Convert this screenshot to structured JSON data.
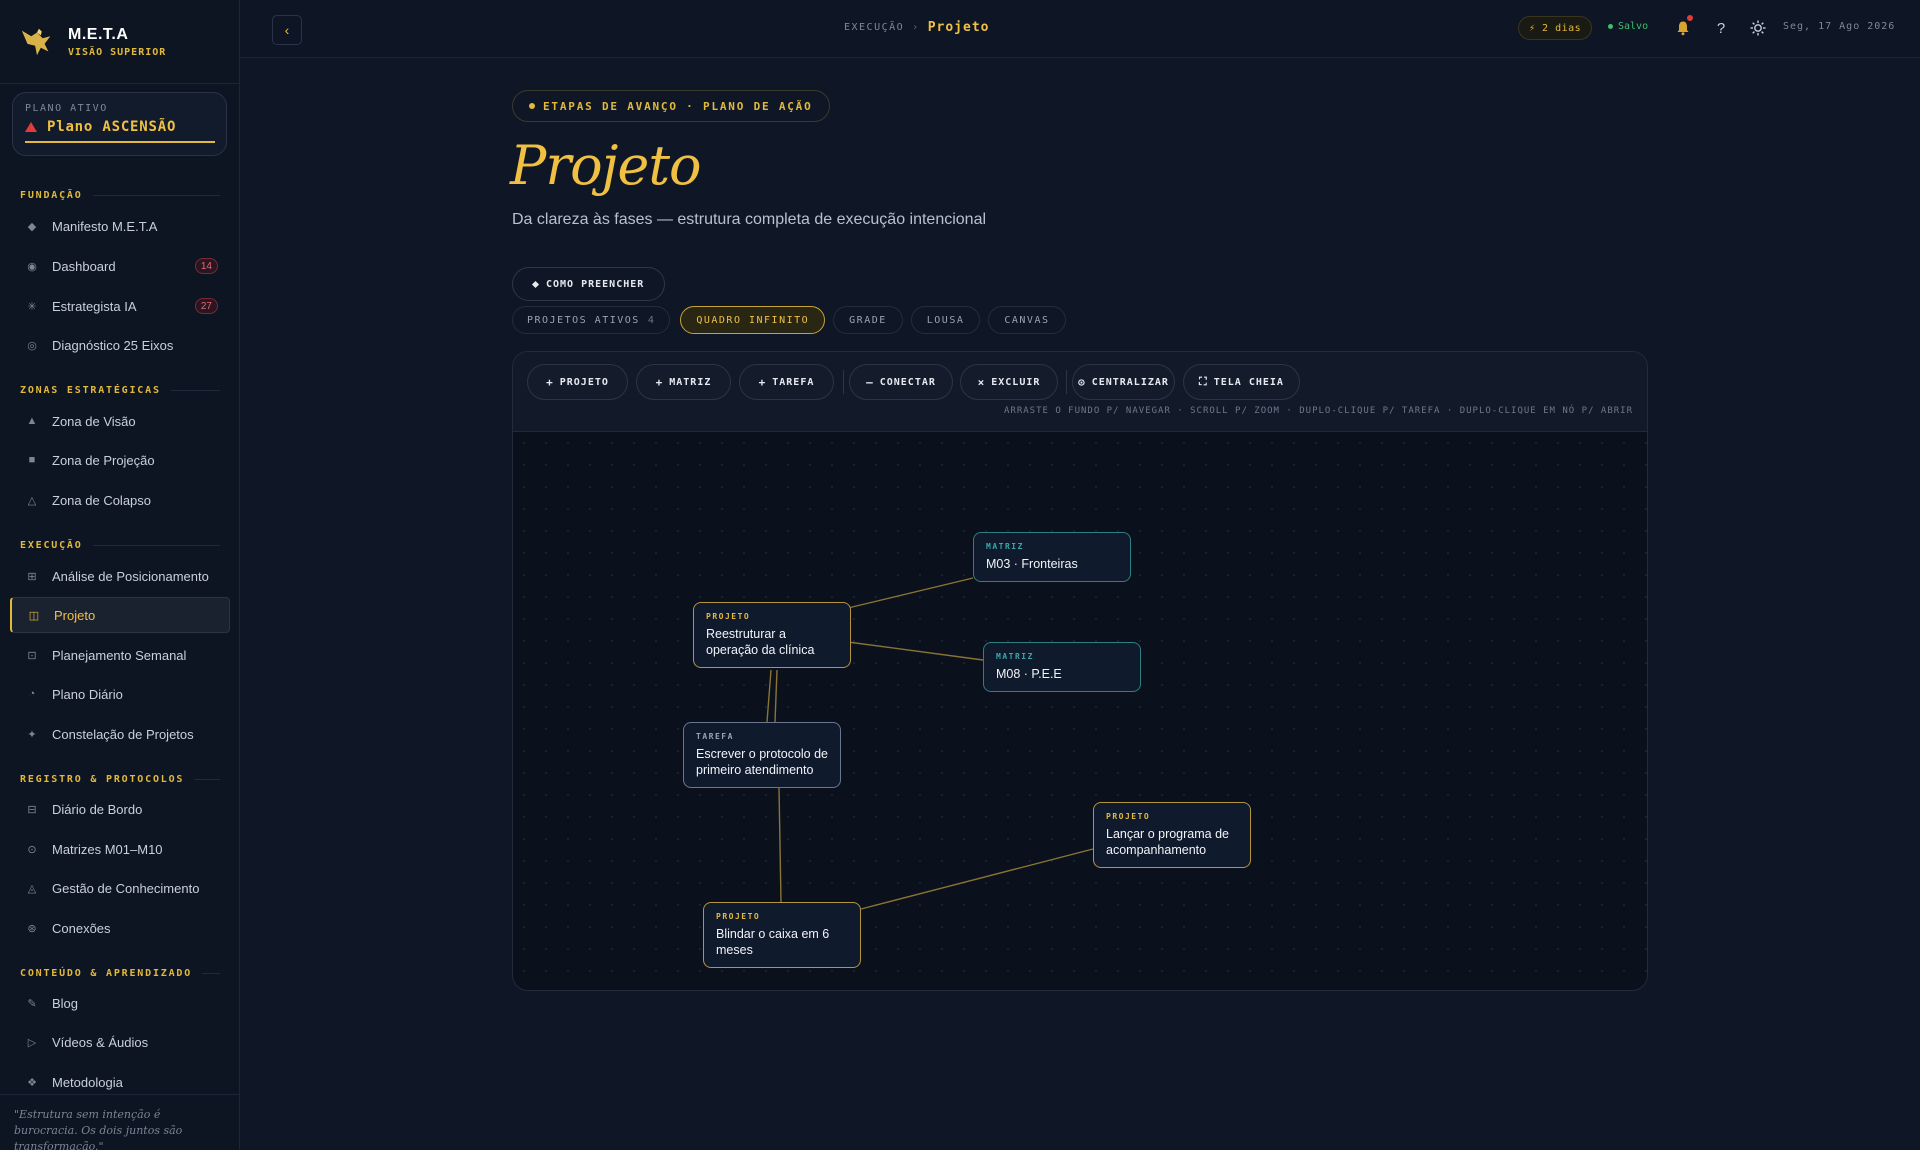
{
  "brand": {
    "name": "M.E.T.A",
    "subtitle": "VISÃO SUPERIOR"
  },
  "plan": {
    "label": "PLANO ATIVO",
    "name": "Plano ASCENSÃO"
  },
  "sidebar": {
    "sections": [
      {
        "title": "FUNDAÇÃO"
      },
      {
        "title": "ZONAS ESTRATÉGICAS"
      },
      {
        "title": "EXECUÇÃO"
      },
      {
        "title": "REGISTRO & PROTOCOLOS"
      },
      {
        "title": "CONTEÚDO & APRENDIZADO"
      }
    ],
    "items": [
      {
        "label": "Manifesto M.E.T.A",
        "icon": "◆"
      },
      {
        "label": "Dashboard",
        "icon": "◉",
        "badge": "14"
      },
      {
        "label": "Estrategista IA",
        "icon": "✳",
        "badge": "27"
      },
      {
        "label": "Diagnóstico 25 Eixos",
        "icon": "◎"
      },
      {
        "label": "Zona de Visão",
        "icon": "▲"
      },
      {
        "label": "Zona de Projeção",
        "icon": "■"
      },
      {
        "label": "Zona de Colapso",
        "icon": "△"
      },
      {
        "label": "Análise de Posicionamento",
        "icon": "⊞"
      },
      {
        "label": "Projeto",
        "icon": "◫"
      },
      {
        "label": "Planejamento Semanal",
        "icon": "⊡"
      },
      {
        "label": "Plano Diário",
        "icon": "◔"
      },
      {
        "label": "Constelação de Projetos",
        "icon": "✦"
      },
      {
        "label": "Diário de Bordo",
        "icon": "⊟"
      },
      {
        "label": "Matrizes M01–M10",
        "icon": "⊙"
      },
      {
        "label": "Gestão de Conhecimento",
        "icon": "◬"
      },
      {
        "label": "Conexões",
        "icon": "⊛"
      },
      {
        "label": "Blog",
        "icon": "✎"
      },
      {
        "label": "Vídeos & Áudios",
        "icon": "▷"
      },
      {
        "label": "Metodologia",
        "icon": "❖"
      }
    ],
    "quote": "\"Estrutura sem intenção é burocracia. Os dois juntos são transformação.\""
  },
  "topbar": {
    "back": "‹",
    "crumb_parent": "EXECUÇÃO",
    "crumb_sep": "›",
    "crumb_current": "Projeto",
    "streak": "⚡ 2 dias",
    "saved": "Salvo",
    "help": "?",
    "date": "Seg, 17 Ago 2026"
  },
  "main": {
    "eyebrow": "ETAPAS DE AVANÇO · PLANO DE AÇÃO",
    "title": "Projeto",
    "subtitle": "Da clareza às fases — estrutura completa de execução intencional",
    "howto": "COMO PREENCHER",
    "view_label": "PROJETOS ATIVOS",
    "view_count": "4",
    "views": [
      "QUADRO INFINITO",
      "GRADE",
      "LOUSA",
      "CANVAS"
    ],
    "toolbar": {
      "add_project": "PROJETO",
      "add_matrix": "MATRIZ",
      "add_task": "TAREFA",
      "connect": "CONECTAR",
      "delete": "EXCLUIR",
      "center": "CENTRALIZAR",
      "fullscreen": "TELA CHEIA",
      "hint": "ARRASTE O FUNDO P/ NAVEGAR · SCROLL P/ ZOOM · DUPLO-CLIQUE P/ TAREFA · DUPLO-CLIQUE EM NÓ P/ ABRIR"
    },
    "nodes": [
      {
        "type": "MATRIZ",
        "text": "M03 · Fronteiras"
      },
      {
        "type": "PROJETO",
        "text": "Reestruturar a operação da clínica"
      },
      {
        "type": "MATRIZ",
        "text": "M08 · P.E.E"
      },
      {
        "type": "TAREFA",
        "text": "Escrever o protocolo de primeiro atendimento"
      },
      {
        "type": "PROJETO",
        "text": "Lançar o programa de acompanhamento"
      },
      {
        "type": "PROJETO",
        "text": "Blindar o caixa em 6 meses"
      }
    ]
  },
  "colors": {
    "accent": "#e2b93b",
    "matrix": "#3aa6ab",
    "alert": "#e33b3b",
    "success": "#3fbf6a"
  }
}
